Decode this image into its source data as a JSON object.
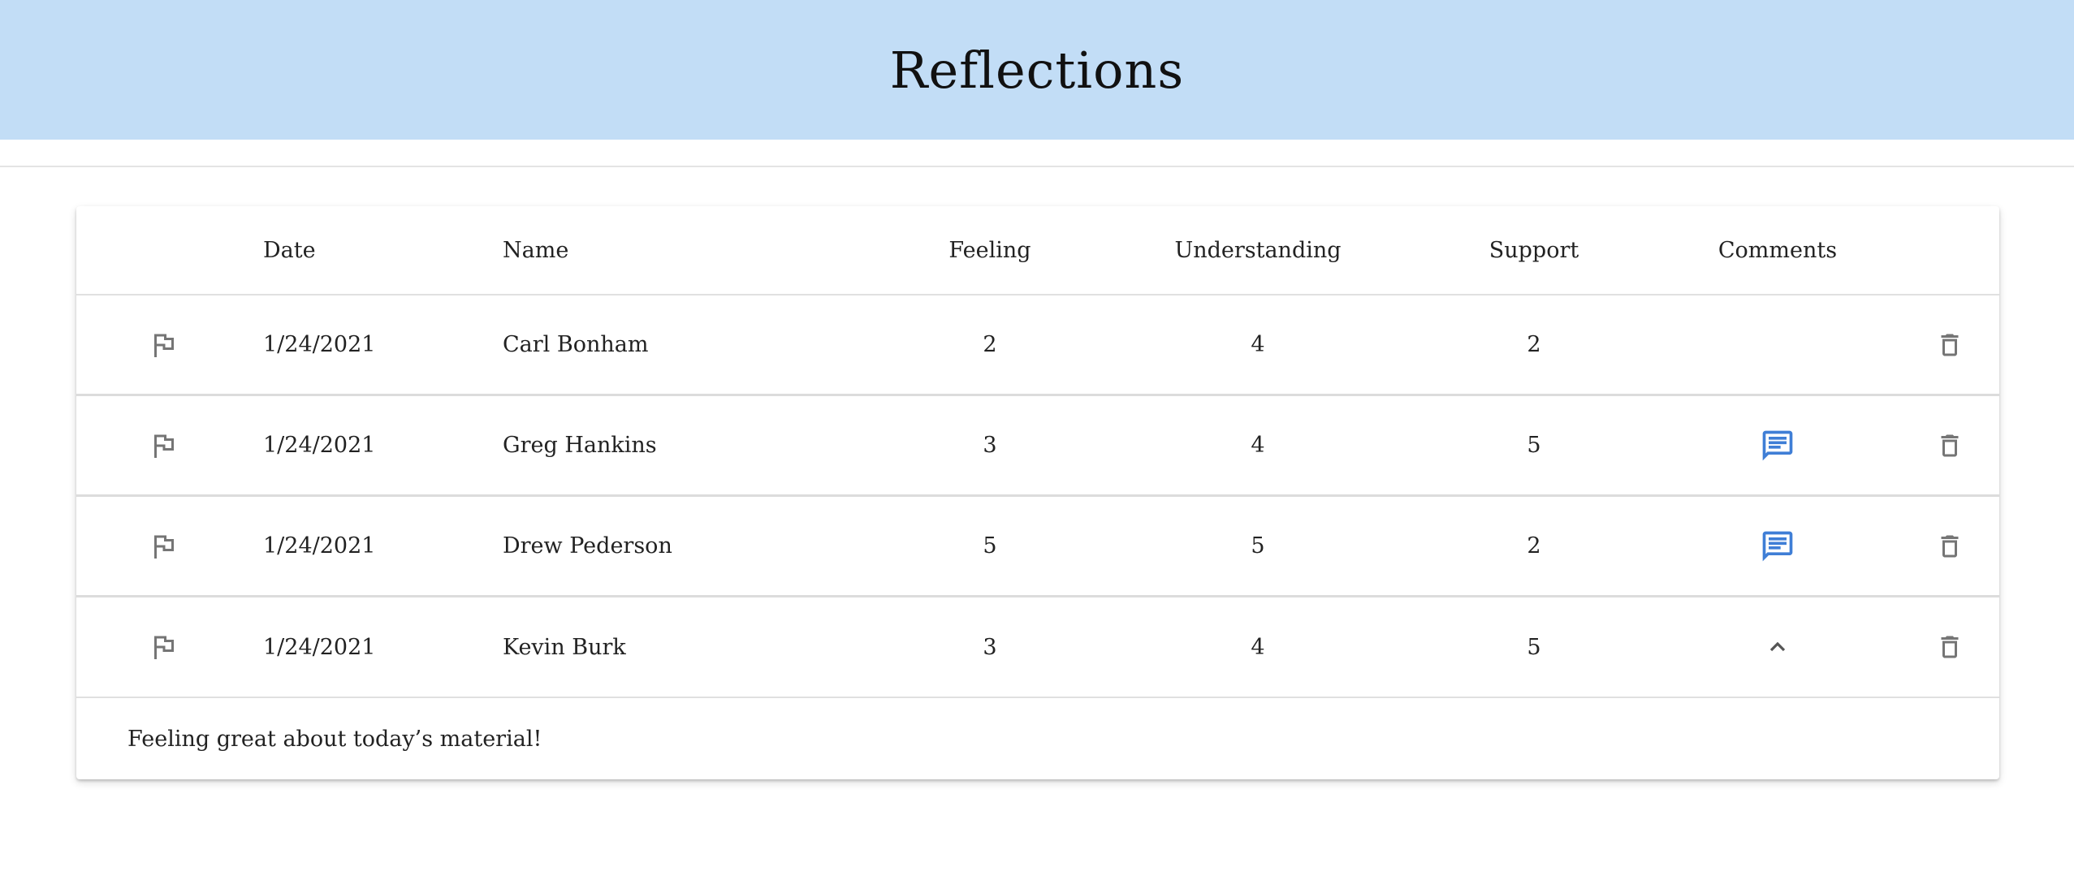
{
  "header": {
    "title": "Reflections"
  },
  "table": {
    "columns": {
      "date": "Date",
      "name": "Name",
      "feeling": "Feeling",
      "understanding": "Understanding",
      "support": "Support",
      "comments": "Comments"
    },
    "rows": [
      {
        "date": "1/24/2021",
        "name": "Carl Bonham",
        "feeling": "2",
        "understanding": "4",
        "support": "2",
        "comment_icon": "none"
      },
      {
        "date": "1/24/2021",
        "name": "Greg Hankins",
        "feeling": "3",
        "understanding": "4",
        "support": "5",
        "comment_icon": "comment-icon"
      },
      {
        "date": "1/24/2021",
        "name": "Drew Pederson",
        "feeling": "5",
        "understanding": "5",
        "support": "2",
        "comment_icon": "comment-icon"
      },
      {
        "date": "1/24/2021",
        "name": "Kevin Burk",
        "feeling": "3",
        "understanding": "4",
        "support": "5",
        "comment_icon": "chevron-up-icon"
      }
    ],
    "expanded_comment": "Feeling great about today’s material!"
  },
  "icons": {
    "flag": "flag-icon",
    "delete": "trash-icon",
    "comment": "comment-icon",
    "collapse": "chevron-up-icon"
  },
  "colors": {
    "header_bg": "#c2ddf6",
    "comment_icon": "#3f7ed6",
    "icon_gray": "#757575"
  }
}
